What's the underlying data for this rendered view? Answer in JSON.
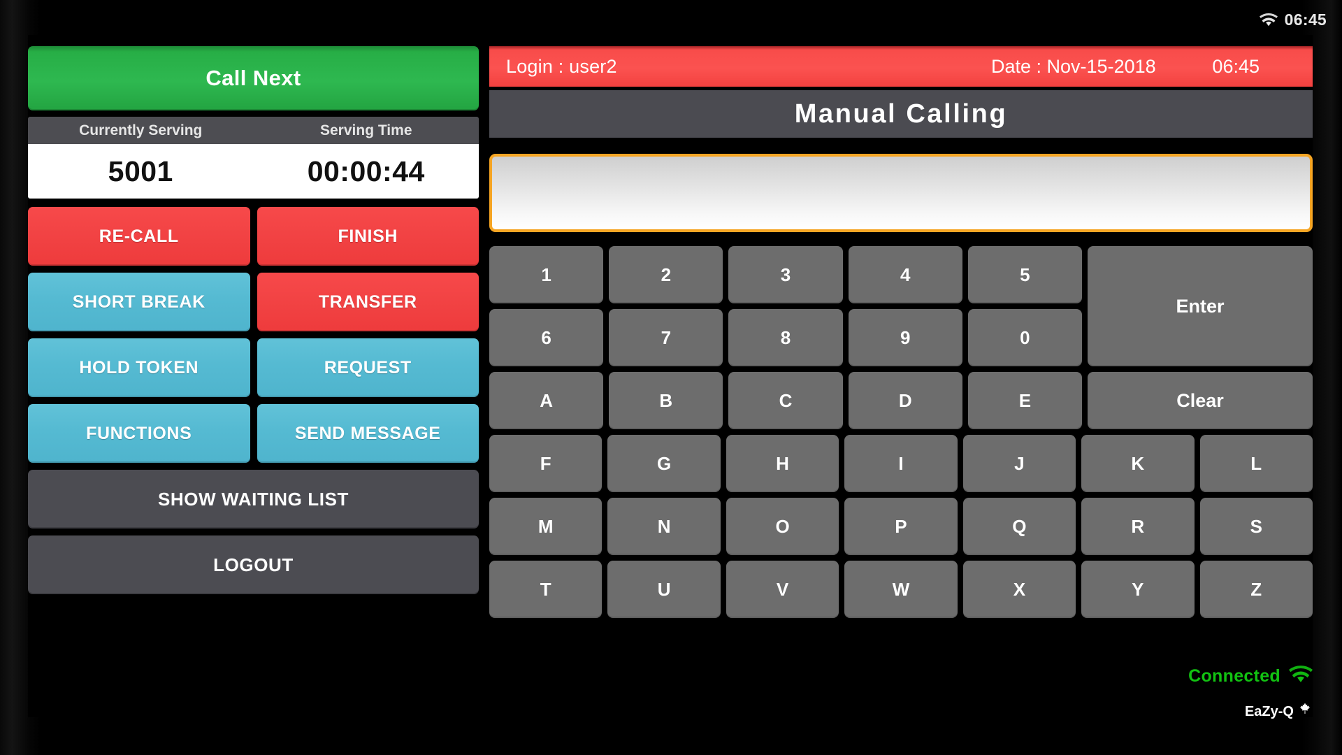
{
  "status_bar": {
    "time": "06:45",
    "wifi_icon": "wifi-icon"
  },
  "left_panel": {
    "call_next_label": "Call Next",
    "serving_headers": {
      "token": "Currently Serving",
      "time": "Serving Time"
    },
    "serving_values": {
      "token": "5001",
      "time": "00:00:44"
    },
    "action_buttons": [
      {
        "label": "RE-CALL",
        "color": "#f24344",
        "style": "red"
      },
      {
        "label": "FINISH",
        "color": "#f24344",
        "style": "red"
      },
      {
        "label": "SHORT BREAK",
        "color": "#55bad2",
        "style": "blue"
      },
      {
        "label": "TRANSFER",
        "color": "#f24344",
        "style": "red"
      },
      {
        "label": "HOLD TOKEN",
        "color": "#55bad2",
        "style": "blue"
      },
      {
        "label": "REQUEST",
        "color": "#55bad2",
        "style": "blue"
      },
      {
        "label": "FUNCTIONS",
        "color": "#55bad2",
        "style": "blue"
      },
      {
        "label": "SEND MESSAGE",
        "color": "#55bad2",
        "style": "blue"
      }
    ],
    "show_waiting_list_label": "SHOW WAITING LIST",
    "logout_label": "LOGOUT"
  },
  "header": {
    "login_label": "Login : user2",
    "date_label": "Date : Nov-15-2018",
    "time_label": "06:45",
    "screen_title": "Manual Calling"
  },
  "entry": {
    "value": "",
    "placeholder": ""
  },
  "keypad": {
    "row1": [
      "1",
      "2",
      "3",
      "4",
      "5"
    ],
    "row2": [
      "6",
      "7",
      "8",
      "9",
      "0"
    ],
    "enter_label": "Enter",
    "row3": [
      "A",
      "B",
      "C",
      "D",
      "E"
    ],
    "clear_label": "Clear",
    "row4": [
      "F",
      "G",
      "H",
      "I",
      "J",
      "K",
      "L"
    ],
    "row5": [
      "M",
      "N",
      "O",
      "P",
      "Q",
      "R",
      "S"
    ],
    "row6": [
      "T",
      "U",
      "V",
      "W",
      "X",
      "Y",
      "Z"
    ]
  },
  "footer": {
    "connection_status": "Connected",
    "connection_color": "#12c212",
    "wifi_icon": "wifi-icon",
    "brand_name": "EaZy-Q",
    "brand_icon": "maple-leaf-icon"
  }
}
